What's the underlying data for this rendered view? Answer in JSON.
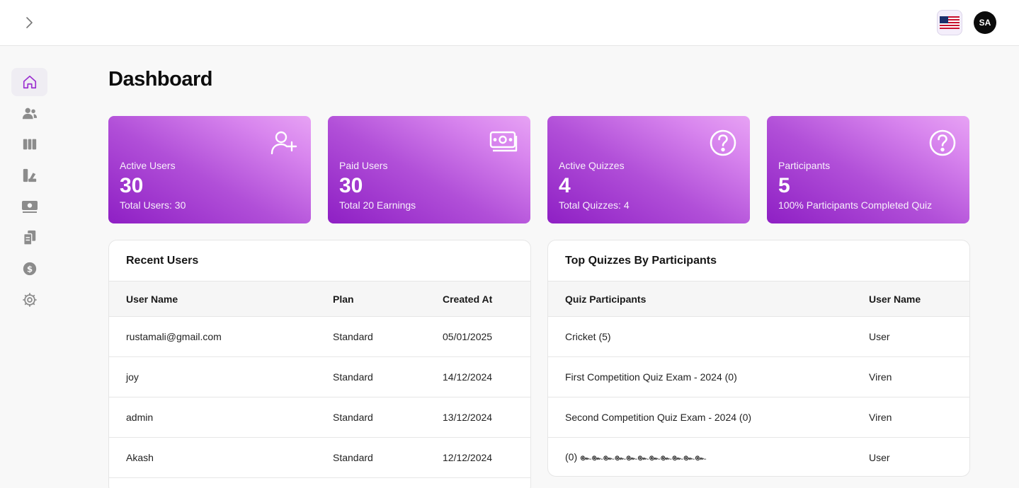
{
  "header": {
    "toggle_icon": "chevron-right-icon",
    "language_icon": "us-flag-icon",
    "avatar_initials": "SA"
  },
  "sidebar": {
    "items": [
      {
        "icon": "home-icon",
        "active": true
      },
      {
        "icon": "users-icon"
      },
      {
        "icon": "columns-icon"
      },
      {
        "icon": "swatches-icon"
      },
      {
        "icon": "money-icon"
      },
      {
        "icon": "documents-icon"
      },
      {
        "icon": "dollar-icon"
      },
      {
        "icon": "settings-icon"
      }
    ]
  },
  "page": {
    "title": "Dashboard"
  },
  "stats": [
    {
      "icon": "user-plus-icon",
      "label": "Active Users",
      "value": "30",
      "sub": "Total Users: 30"
    },
    {
      "icon": "money-icon",
      "label": "Paid Users",
      "value": "30",
      "sub": "Total 20 Earnings"
    },
    {
      "icon": "question-icon",
      "label": "Active Quizzes",
      "value": "4",
      "sub": "Total Quizzes: 4"
    },
    {
      "icon": "question-icon",
      "label": "Participants",
      "value": "5",
      "sub": "100% Participants Completed Quiz"
    }
  ],
  "recent_users": {
    "title": "Recent Users",
    "columns": [
      "User Name",
      "Plan",
      "Created At"
    ],
    "rows": [
      [
        "rustamali@gmail.com",
        "Standard",
        "05/01/2025"
      ],
      [
        "joy",
        "Standard",
        "14/12/2024"
      ],
      [
        "admin",
        "Standard",
        "13/12/2024"
      ],
      [
        "Akash",
        "Standard",
        "12/12/2024"
      ]
    ]
  },
  "top_quizzes": {
    "title": "Top Quizzes By Participants",
    "columns": [
      "Quiz Participants",
      "User Name"
    ],
    "rows": [
      [
        "Cricket (5)",
        "User"
      ],
      [
        "First Competition Quiz Exam - 2024 (0)",
        "Viren"
      ],
      [
        "Second Competition Quiz Exam - 2024 (0)",
        "Viren"
      ],
      [
        "(0) ๛๛๛๛๛๛๛๛๛๛๛",
        "User"
      ]
    ]
  },
  "colors": {
    "accent": "#9b2fd0",
    "card_gradient_start": "#8e1fc4",
    "card_gradient_end": "#e7a3f4"
  }
}
